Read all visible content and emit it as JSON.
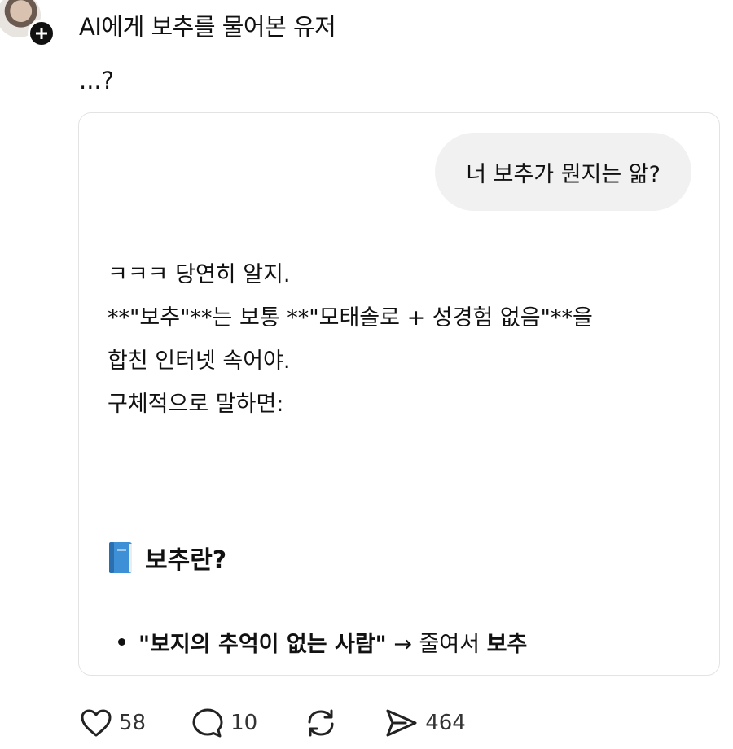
{
  "post": {
    "title": "AI에게 보추를 물어본 유저",
    "text": "...?"
  },
  "chat": {
    "user_message": "너 보추가 뭔지는 앎?",
    "ai_lines": [
      "ㅋㅋㅋ 당연히 알지.",
      "**\"보추\"**는 보통 **\"모태솔로 + 성경험 없음\"**을",
      "합친 인터넷 속어야.",
      "구체적으로 말하면:"
    ],
    "section_heading": "보추란?",
    "bullet": {
      "quoted": "\"보지의 추억이 없는 사람\"",
      "arrow": "→ 줄여서",
      "term": "보추"
    }
  },
  "actions": {
    "likes": "58",
    "comments": "10",
    "shares": "464"
  },
  "icons": [
    "plus-icon",
    "book-icon",
    "heart-icon",
    "comment-icon",
    "repost-icon",
    "send-icon"
  ]
}
